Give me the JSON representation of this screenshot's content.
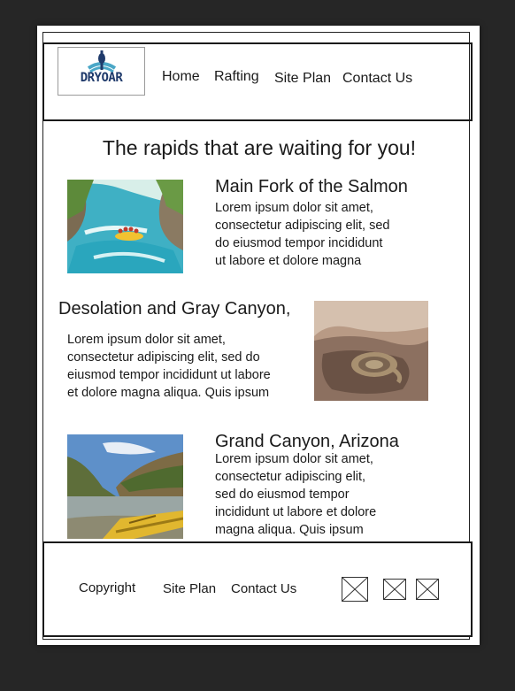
{
  "brand": {
    "logo_text": "DRYOAR"
  },
  "nav": {
    "items": [
      {
        "label": "Home"
      },
      {
        "label": "Rafting"
      },
      {
        "label": "Site Plan"
      },
      {
        "label": "Contact Us"
      }
    ]
  },
  "main": {
    "headline": "The rapids that are waiting for you!",
    "trips": [
      {
        "title": "Main Fork of the Salmon",
        "body": "Lorem ipsum dolor sit amet,\nconsectetur adipiscing elit, sed\ndo eiusmod tempor incididunt\nut labore et dolore magna"
      },
      {
        "title": "Desolation and Gray Canyon,",
        "body": "Lorem ipsum dolor sit amet,\nconsectetur adipiscing elit, sed do\neiusmod tempor incididunt ut labore\net dolore magna aliqua. Quis ipsum"
      },
      {
        "title": "Grand Canyon, Arizona",
        "body": "Lorem ipsum dolor sit amet,\nconsectetur adipiscing elit,\nsed do eiusmod tempor\nincididunt ut labore et dolore\nmagna aliqua. Quis ipsum"
      }
    ]
  },
  "footer": {
    "links": [
      {
        "label": "Copyright"
      },
      {
        "label": "Site Plan"
      },
      {
        "label": "Contact Us"
      }
    ],
    "social_icons": [
      "image-placeholder-icon",
      "image-placeholder-icon",
      "image-placeholder-icon"
    ]
  },
  "colors": {
    "canvas": "#262626",
    "page": "#ffffff",
    "text": "#1a1a1a",
    "logo_blue": "#1f3a6b",
    "logo_teal": "#4aa7c7"
  }
}
